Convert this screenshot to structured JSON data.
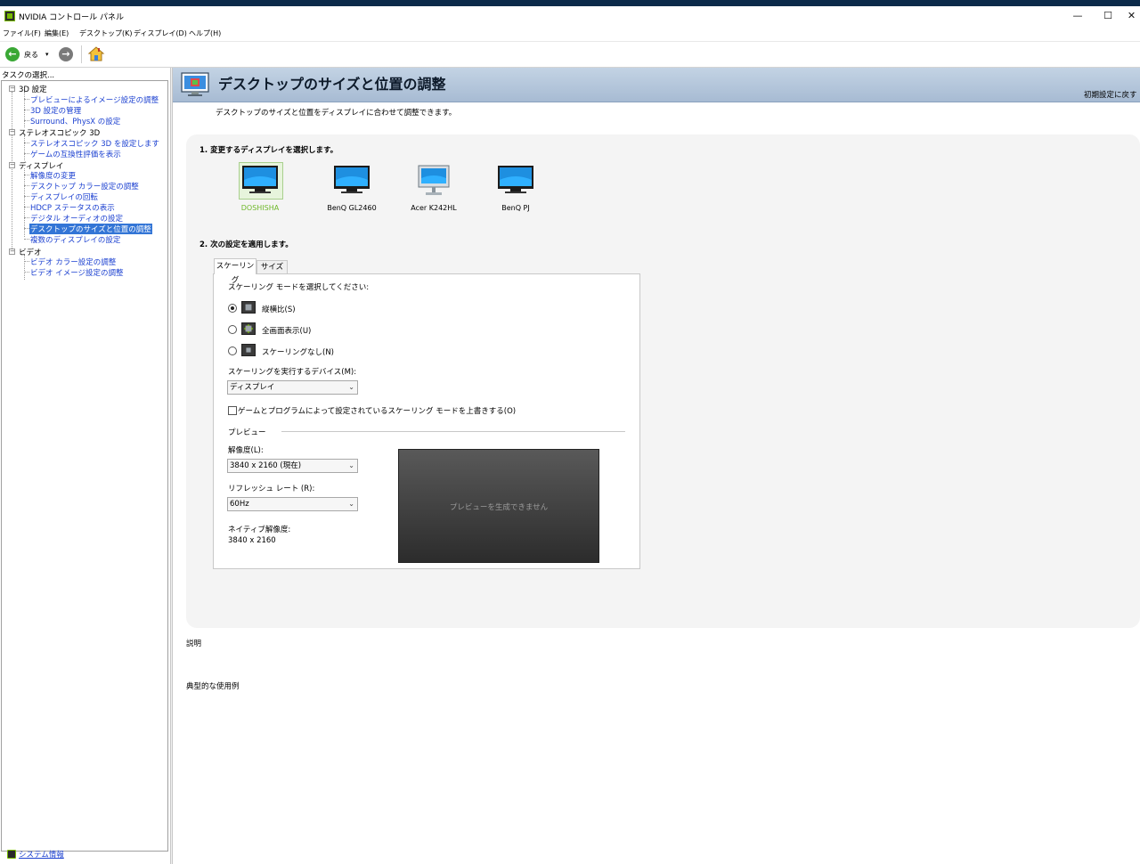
{
  "window": {
    "title": "NVIDIA コントロール パネル",
    "controls": [
      "—",
      "☐",
      "✕"
    ]
  },
  "menu": [
    "ファイル(F)",
    "編集(E)",
    "デスクトップ(K)",
    "ディスプレイ(D)",
    "ヘルプ(H)"
  ],
  "toolbar": {
    "back_label": "戻る",
    "back_dropdown": "▾",
    "back_arrow": "←",
    "forward_arrow": "→"
  },
  "sidebar": {
    "header": "タスクの選択...",
    "categories": [
      {
        "label": "3D 設定",
        "expander": "−",
        "items": [
          "プレビューによるイメージ設定の調整",
          "3D 設定の管理",
          "Surround、PhysX の設定"
        ]
      },
      {
        "label": "ステレオスコピック 3D",
        "expander": "−",
        "items": [
          "ステレオスコピック 3D を設定します",
          "ゲームの互換性評価を表示"
        ]
      },
      {
        "label": "ディスプレイ",
        "expander": "−",
        "items": [
          "解像度の変更",
          "デスクトップ カラー設定の調整",
          "ディスプレイの回転",
          "HDCP ステータスの表示",
          "デジタル オーディオの設定",
          "デスクトップのサイズと位置の調整",
          "複数のディスプレイの設定"
        ]
      },
      {
        "label": "ビデオ",
        "expander": "−",
        "items": [
          "ビデオ カラー設定の調整",
          "ビデオ イメージ設定の調整"
        ]
      }
    ],
    "selected_item": "デスクトップのサイズと位置の調整",
    "system_info": "システム情報"
  },
  "content": {
    "title": "デスクトップのサイズと位置の調整",
    "restore_defaults": "初期設定に戻す",
    "description": "デスクトップのサイズと位置をディスプレイに合わせて調整できます。",
    "step1": "1. 変更するディスプレイを選択します。",
    "displays": [
      {
        "name": "DOSHISHA",
        "selected": true,
        "icon": "monitor-icon"
      },
      {
        "name": "BenQ GL2460",
        "selected": false,
        "icon": "monitor-icon"
      },
      {
        "name": "Acer K242HL",
        "selected": false,
        "icon": "monitor-stand-icon"
      },
      {
        "name": "BenQ PJ",
        "selected": false,
        "icon": "monitor-icon"
      }
    ],
    "step2": "2. 次の設定を適用します。",
    "tabs": [
      {
        "label": "スケーリング",
        "active": true
      },
      {
        "label": "サイズ",
        "active": false
      }
    ],
    "scaling_mode_label": "スケーリング モードを選択してください:",
    "scaling_modes": [
      {
        "label": "縦横比(S)",
        "checked": true
      },
      {
        "label": "全画面表示(U)",
        "checked": false
      },
      {
        "label": "スケーリングなし(N)",
        "checked": false
      }
    ],
    "device_label": "スケーリングを実行するデバイス(M):",
    "device_value": "ディスプレイ",
    "override_label": "ゲームとプログラムによって設定されているスケーリング モードを上書きする(O)",
    "override_checked": false,
    "preview_heading": "プレビュー",
    "resolution_label": "解像度(L):",
    "resolution_value": "3840 x 2160 (現在)",
    "refresh_label": "リフレッシュ レート (R):",
    "refresh_value": "60Hz",
    "native_label": "ネイティブ解像度:",
    "native_value": "3840 x 2160",
    "preview_message": "プレビューを生成できません",
    "explanation_heading": "説明",
    "usage_heading": "典型的な使用例"
  },
  "colors": {
    "nvidia_green": "#76b900",
    "link_blue": "#1a3fd0",
    "selection": "#3375d6",
    "banner": "#a7bbd3"
  }
}
